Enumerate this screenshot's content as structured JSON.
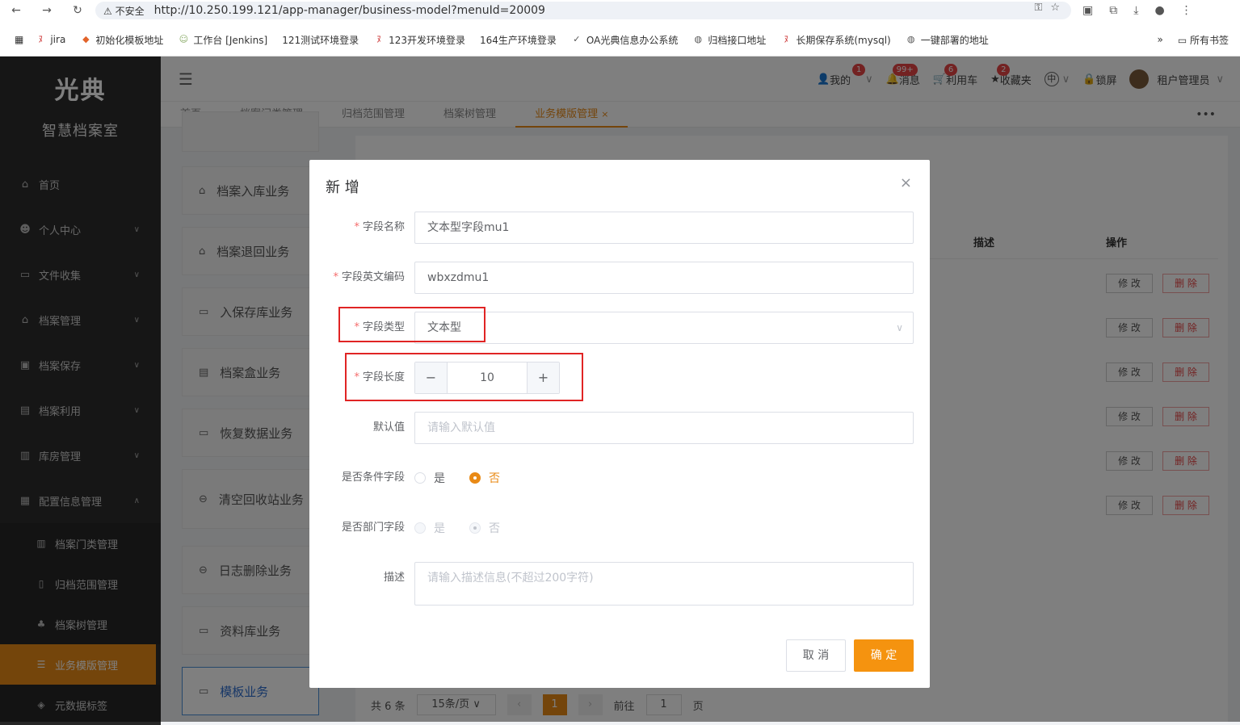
{
  "browser": {
    "security": "不安全",
    "url": "http://10.250.199.121/app-manager/business-model?menuId=20009",
    "bookmarks": [
      "jira",
      "初始化模板地址",
      "工作台 [Jenkins]",
      "121测试环境登录",
      "123开发环境登录",
      "164生产环境登录",
      "OA光典信息办公系统",
      "归档接口地址",
      "长期保存系统(mysql)",
      "一键部署的地址"
    ],
    "all_bookmarks": "所有书签"
  },
  "sidebar": {
    "logo": "光典",
    "subtitle": "智慧档案室",
    "items": [
      {
        "label": "首页",
        "icon": "home-icon"
      },
      {
        "label": "个人中心",
        "icon": "user-icon"
      },
      {
        "label": "文件收集",
        "icon": "folder-icon"
      },
      {
        "label": "档案管理",
        "icon": "bank-icon"
      },
      {
        "label": "档案保存",
        "icon": "archive-icon"
      },
      {
        "label": "档案利用",
        "icon": "clipboard-icon"
      },
      {
        "label": "库房管理",
        "icon": "building-icon"
      },
      {
        "label": "配置信息管理",
        "icon": "config-icon"
      }
    ],
    "subitems": [
      {
        "label": "档案门类管理"
      },
      {
        "label": "归档范围管理"
      },
      {
        "label": "档案树管理"
      },
      {
        "label": "业务模版管理"
      },
      {
        "label": "元数据标签"
      }
    ]
  },
  "header": {
    "mine": "我的",
    "mine_badge": "1",
    "messages": "消息",
    "messages_badge": "99+",
    "cart": "利用车",
    "cart_badge": "6",
    "favorites": "收藏夹",
    "favorites_badge": "2",
    "lang": "中",
    "lock": "锁屏",
    "user": "租户管理员"
  },
  "tabs": [
    "首页",
    "档案门类管理",
    "归档范围管理",
    "档案树管理",
    "业务模版管理"
  ],
  "left_panel": [
    "档案入库业务",
    "档案退回业务",
    "入保存库业务",
    "档案盒业务",
    "恢复数据业务",
    "清空回收站业务",
    "日志删除业务",
    "资料库业务",
    "模板业务"
  ],
  "table": {
    "col_desc": "描述",
    "col_ops": "操作",
    "edit": "修 改",
    "delete": "删 除"
  },
  "pager": {
    "total": "共 6 条",
    "size": "15条/页",
    "current": "1",
    "goto": "前往",
    "goto_val": "1",
    "page": "页"
  },
  "dialog": {
    "title": "新 增",
    "field_name_label": "字段名称",
    "field_name_value": "文本型字段mu1",
    "field_code_label": "字段英文编码",
    "field_code_value": "wbxzdmu1",
    "field_type_label": "字段类型",
    "field_type_value": "文本型",
    "field_length_label": "字段长度",
    "field_length_value": "10",
    "default_label": "默认值",
    "default_placeholder": "请输入默认值",
    "condition_label": "是否条件字段",
    "dept_label": "是否部门字段",
    "yes": "是",
    "no": "否",
    "desc_label": "描述",
    "desc_placeholder": "请输入描述信息(不超过200字符)",
    "cancel": "取 消",
    "ok": "确 定"
  }
}
